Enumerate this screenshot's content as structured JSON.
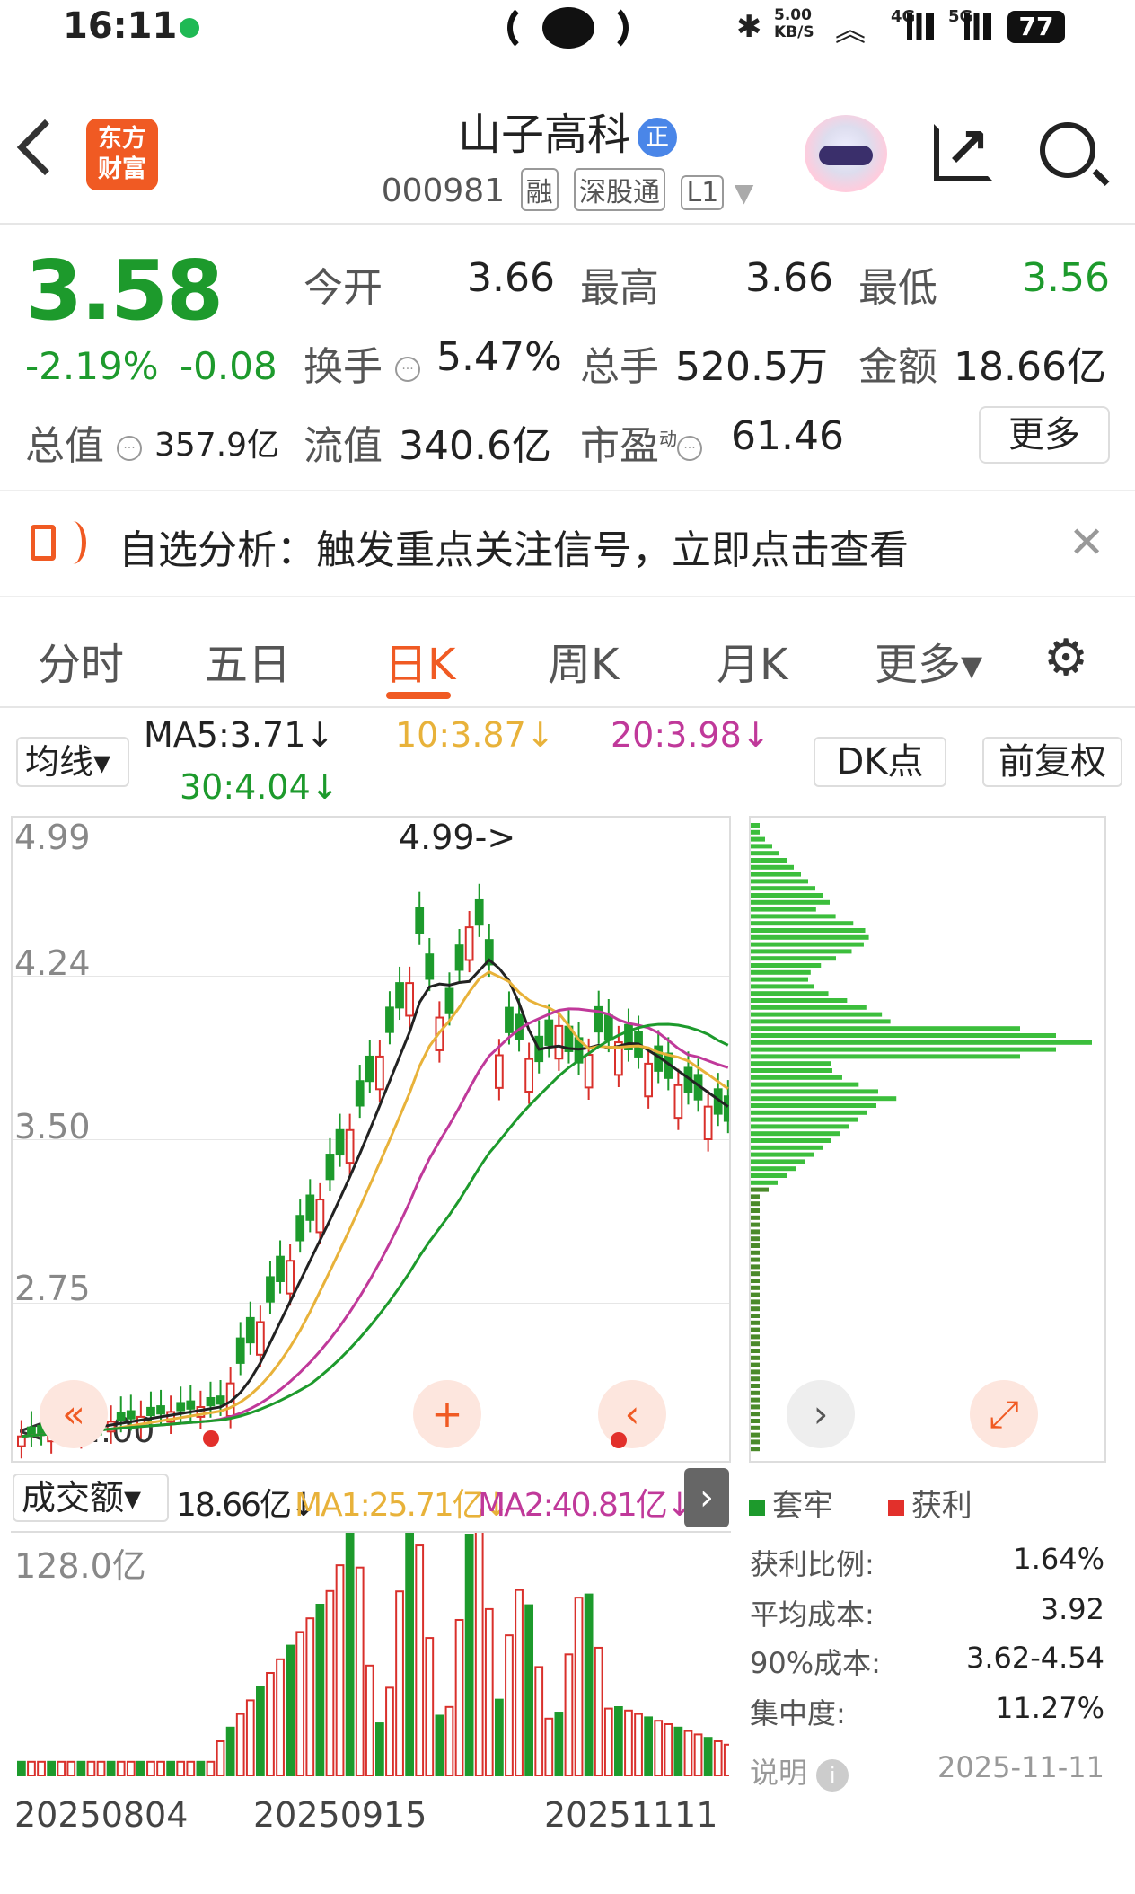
{
  "status_bar": {
    "time": "16:11",
    "net_speed": "5.00 KB/S",
    "signal1": "4G",
    "signal2": "5G",
    "battery": "77"
  },
  "header": {
    "logo_text_1": "东方",
    "logo_text_2": "财富",
    "stock_name": "山子高科",
    "badge": "正",
    "stock_code": "000981",
    "tags": [
      "融",
      "深股通",
      "L1"
    ]
  },
  "quote": {
    "price": "3.58",
    "change_pct": "-2.19%",
    "change": "-0.08",
    "open_label": "今开",
    "open": "3.66",
    "high_label": "最高",
    "high": "3.66",
    "low_label": "最低",
    "low": "3.56",
    "turnover_label": "换手",
    "turnover": "5.47%",
    "volume_label": "总手",
    "volume": "520.5万",
    "amount_label": "金额",
    "amount": "18.66亿",
    "mktcap_label": "总值",
    "mktcap": "357.9亿",
    "float_label": "流值",
    "float": "340.6亿",
    "pe_label": "市盈",
    "pe_sup": "动",
    "pe": "61.46",
    "more_label": "更多"
  },
  "banner": {
    "text": "自选分析：触发重点关注信号，立即点击查看"
  },
  "tabs": [
    "分时",
    "五日",
    "日K",
    "周K",
    "月K",
    "更多▾"
  ],
  "ma_row": {
    "selector": "均线▾",
    "ma5": "MA5:3.71↓",
    "ma10": "10:3.87↓",
    "ma20": "20:3.98↓",
    "ma30": "30:4.04↓",
    "dk": "DK点",
    "adjust": "前复权"
  },
  "kline": {
    "y_labels": [
      "4.99",
      "4.24",
      "3.50",
      "2.75",
      "2.00"
    ],
    "max_annot": "4.99->",
    "min_annot": "<—2.00"
  },
  "volume": {
    "selector": "成交额▾",
    "amount": "18.66亿↓",
    "ma1": "MA1:25.71亿↓",
    "ma2": "MA2:40.81亿↓",
    "y_label": "128.0亿"
  },
  "dates": [
    "20250804",
    "20250915",
    "20251111"
  ],
  "chip": {
    "legend_trapped": "套牢",
    "legend_profit": "获利",
    "stats": [
      {
        "label": "获利比例:",
        "value": "1.64%"
      },
      {
        "label": "平均成本:",
        "value": "3.92"
      },
      {
        "label": "90%成本:",
        "value": "3.62-4.54"
      },
      {
        "label": "集中度:",
        "value": "11.27%"
      }
    ],
    "note": "说明",
    "date": "2025-11-11"
  },
  "colors": {
    "up": "#d9302b",
    "down": "#1d9a2c",
    "accent": "#f05a23",
    "ma5": "#222222",
    "ma10": "#e8b23a",
    "ma20": "#c0399a",
    "ma30": "#1d9a2c"
  }
}
